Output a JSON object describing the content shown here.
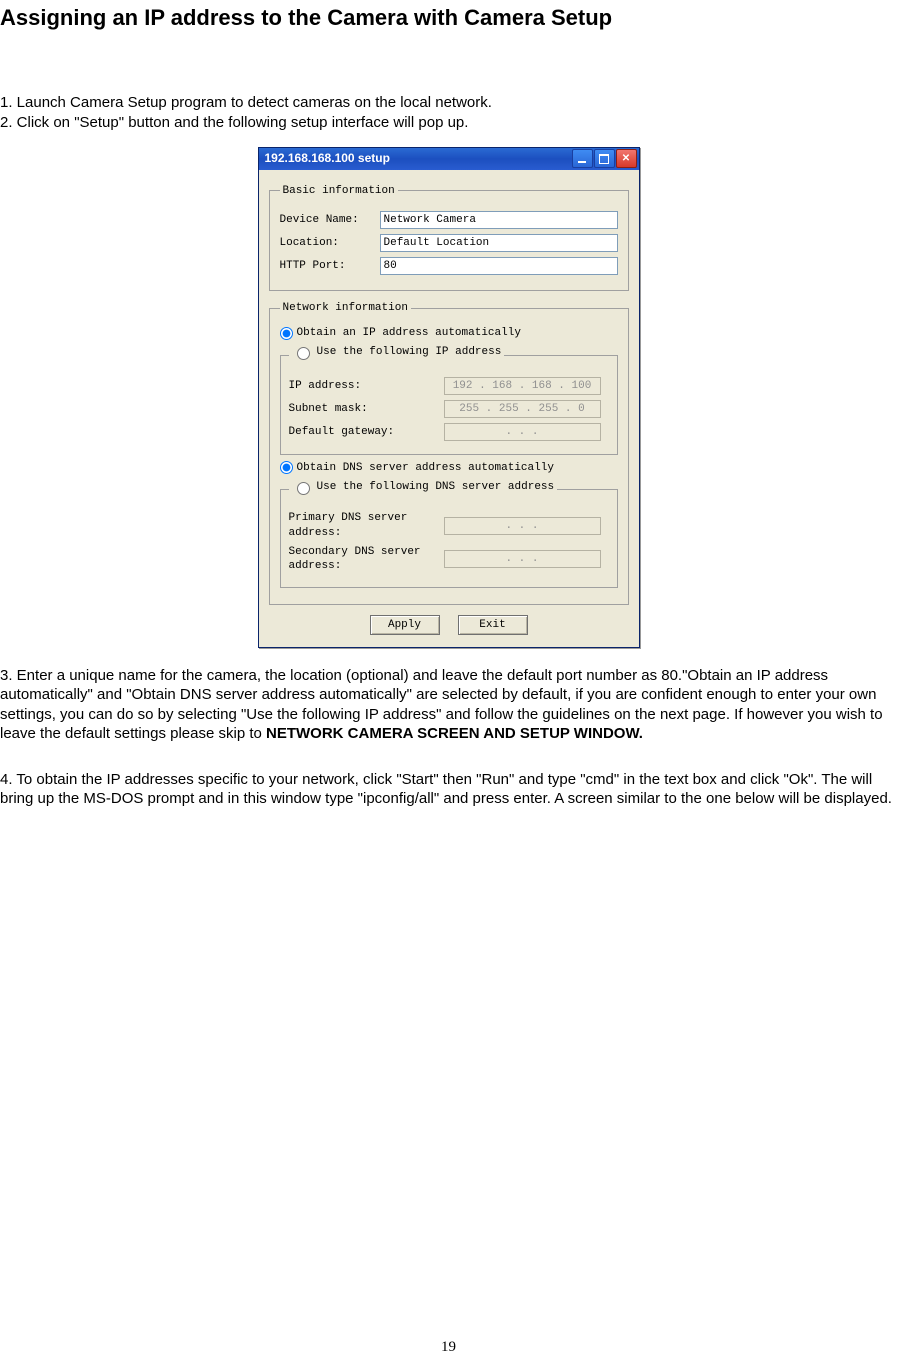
{
  "page": {
    "title": "Assigning an IP address to the Camera with Camera Setup",
    "intro_line1": "1. Launch Camera Setup program to detect cameras on the local network.",
    "intro_line2": "2. Click on \"Setup\" button and the following setup interface will pop up.",
    "para3_pre": "3. Enter a unique name for the camera, the location (optional) and leave the default port number as 80.\"Obtain an IP address automatically\" and \"Obtain DNS server address automatically\" are selected by default, if you are confident enough to enter your own settings, you can do so by selecting \"Use the following IP address\" and follow the guidelines on the next page. If however you wish to leave the default settings please skip to ",
    "para3_bold": "NETWORK CAMERA SCREEN AND SETUP WINDOW.",
    "para4": "4. To obtain the IP addresses specific to your network, click \"Start\" then \"Run\" and type \"cmd\" in the text box and click \"Ok\". The will bring up the MS-DOS prompt and in this window type \"ipconfig/all\" and press enter. A screen similar to the one below will be displayed.",
    "number": "19"
  },
  "dialog": {
    "title": "192.168.168.100 setup",
    "groups": {
      "basic": {
        "legend": "Basic information",
        "device_name_label": "Device Name:",
        "device_name_value": "Network Camera",
        "location_label": "Location:",
        "location_value": "Default Location",
        "http_port_label": "HTTP Port:",
        "http_port_value": "80"
      },
      "network": {
        "legend": "Network information",
        "obtain_ip_auto": "Obtain an IP address automatically",
        "use_following_ip": "Use the following IP address",
        "ip_label": "IP address:",
        "ip_value": "192 . 168 . 168 . 100",
        "subnet_label": "Subnet mask:",
        "subnet_value": "255 . 255 . 255 .   0",
        "gateway_label": "Default gateway:",
        "gateway_value": " .       .       . ",
        "obtain_dns_auto": "Obtain DNS server address automatically",
        "use_following_dns": "Use the following DNS server address",
        "primary_dns_label": "Primary DNS server address:",
        "primary_dns_value": " .       .       . ",
        "secondary_dns_label": "Secondary DNS server address:",
        "secondary_dns_value": " .       .       . "
      }
    },
    "buttons": {
      "apply": "Apply",
      "exit": "Exit"
    }
  }
}
